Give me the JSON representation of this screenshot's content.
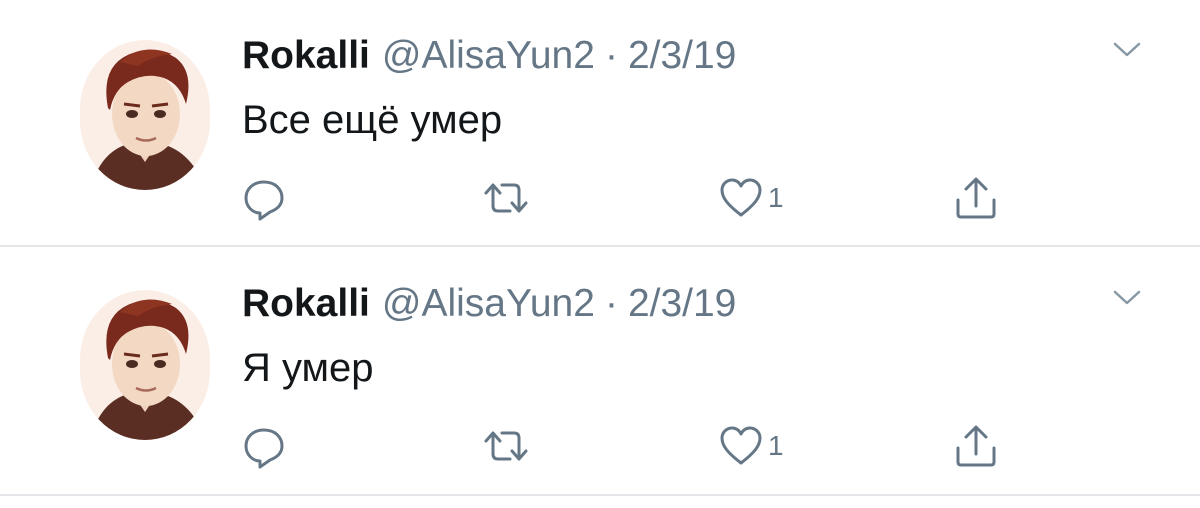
{
  "colors": {
    "text": "#14171a",
    "secondary": "#657786",
    "divider": "#e3e5e8",
    "avatar_hair": "#7a2a1c",
    "avatar_skin": "#f3d9c4"
  },
  "tweets": [
    {
      "name": "Rokalli",
      "handle": "@AlisaYun2",
      "separator": "·",
      "date": "2/3/19",
      "text": "Все ещё умер",
      "likes": "1",
      "icons": [
        "chevron-down-icon",
        "reply-icon",
        "retweet-icon",
        "heart-icon",
        "share-icon"
      ]
    },
    {
      "name": "Rokalli",
      "handle": "@AlisaYun2",
      "separator": "·",
      "date": "2/3/19",
      "text": "Я умер",
      "likes": "1",
      "icons": [
        "chevron-down-icon",
        "reply-icon",
        "retweet-icon",
        "heart-icon",
        "share-icon"
      ]
    }
  ]
}
